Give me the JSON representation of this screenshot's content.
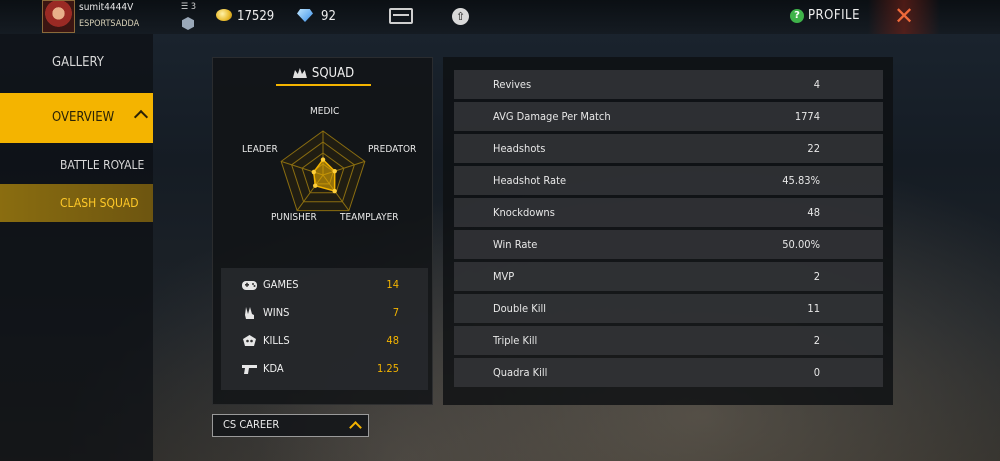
{
  "header": {
    "username": "sumit4444V",
    "guild": "ESPORTSADDA",
    "level": "3",
    "gold": "17529",
    "diamonds": "92",
    "profile_label": "PROFILE"
  },
  "sidebar": {
    "gallery": "GALLERY",
    "overview": "OVERVIEW",
    "battle_royale": "BATTLE ROYALE",
    "clash_squad": "CLASH SQUAD"
  },
  "squad": {
    "title": "SQUAD",
    "radar_labels": {
      "medic": "MEDIC",
      "predator": "PREDATOR",
      "teamplayer": "TEAMPLAYER",
      "punisher": "PUNISHER",
      "leader": "LEADER"
    },
    "radar_values": {
      "medic": 0.35,
      "predator": 0.28,
      "teamplayer": 0.45,
      "punisher": 0.3,
      "leader": 0.22
    },
    "stats": [
      {
        "label": "GAMES",
        "value": "14",
        "icon": "gamepad-icon"
      },
      {
        "label": "WINS",
        "value": "7",
        "icon": "victory-hand-icon"
      },
      {
        "label": "KILLS",
        "value": "48",
        "icon": "skull-icon"
      },
      {
        "label": "KDA",
        "value": "1.25",
        "icon": "gun-icon"
      }
    ]
  },
  "career_dropdown": {
    "label": "CS CAREER"
  },
  "detail_stats": [
    {
      "label": "Revives",
      "value": "4"
    },
    {
      "label": "AVG Damage Per Match",
      "value": "1774"
    },
    {
      "label": "Headshots",
      "value": "22"
    },
    {
      "label": "Headshot Rate",
      "value": "45.83%"
    },
    {
      "label": "Knockdowns",
      "value": "48"
    },
    {
      "label": "Win Rate",
      "value": "50.00%"
    },
    {
      "label": "MVP",
      "value": "2"
    },
    {
      "label": "Double Kill",
      "value": "11"
    },
    {
      "label": "Triple Kill",
      "value": "2"
    },
    {
      "label": "Quadra Kill",
      "value": "0"
    }
  ],
  "colors": {
    "accent": "#f4b400",
    "close": "#f06a3a",
    "help": "#3fb34a"
  }
}
